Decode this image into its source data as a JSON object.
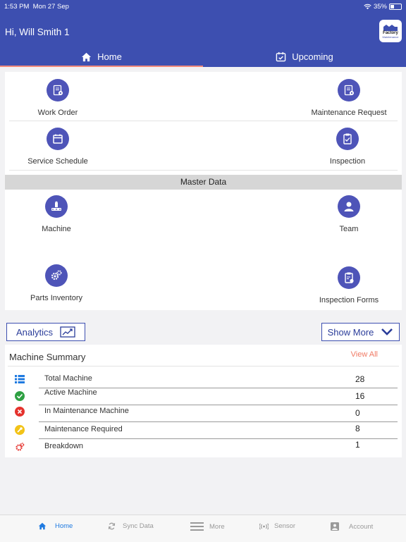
{
  "status_bar": {
    "time": "1:53 PM",
    "date": "Mon 27 Sep",
    "battery": "35%",
    "battery_level": 0.35
  },
  "header": {
    "greeting": "Hi, Will Smith 1",
    "logo_line1": "Factory",
    "logo_line2": "Maintenance"
  },
  "tabs": [
    {
      "label": "Home",
      "icon": "home-icon",
      "active": true
    },
    {
      "label": "Upcoming",
      "icon": "calendar-check-icon",
      "active": false
    }
  ],
  "grid": {
    "work_order": "Work Order",
    "maintenance_request": "Maintenance Request",
    "service_schedule": "Service Schedule",
    "inspection": "Inspection"
  },
  "master_data": {
    "title": "Master Data",
    "machine": "Machine",
    "team": "Team",
    "parts_inventory": "Parts Inventory",
    "inspection_forms": "Inspection Forms"
  },
  "buttons": {
    "analytics": "Analytics",
    "show_more": "Show More"
  },
  "summary": {
    "title": "Machine Summary",
    "view_all": "View All",
    "rows": [
      {
        "label": "Total Machine",
        "value": "28",
        "icon": "list-icon",
        "color": "#1f7ae0"
      },
      {
        "label": "Active Machine",
        "value": "16",
        "icon": "check-circle-icon",
        "color": "#2ea043"
      },
      {
        "label": "In Maintenance Machine",
        "value": "0",
        "icon": "x-circle-icon",
        "color": "#e5322d"
      },
      {
        "label": "Maintenance Required",
        "value": "8",
        "icon": "wrench-icon",
        "color": "#f2c318"
      },
      {
        "label": "Breakdown",
        "value": "1",
        "icon": "gears-icon",
        "color": "#e5322d"
      }
    ]
  },
  "bottom_nav": [
    {
      "label": "Home",
      "icon": "home-icon",
      "active": true
    },
    {
      "label": "Sync Data",
      "icon": "sync-icon",
      "active": false
    },
    {
      "label": "More",
      "icon": "menu-icon",
      "active": false
    },
    {
      "label": "Sensor",
      "icon": "sensor-icon",
      "active": false
    },
    {
      "label": "Account",
      "icon": "account-icon",
      "active": false
    }
  ],
  "colors": {
    "primary": "#3d4fb0",
    "accent": "#f28a7c",
    "icon_circle": "#4e54b8",
    "active_nav": "#1f7ae0"
  }
}
